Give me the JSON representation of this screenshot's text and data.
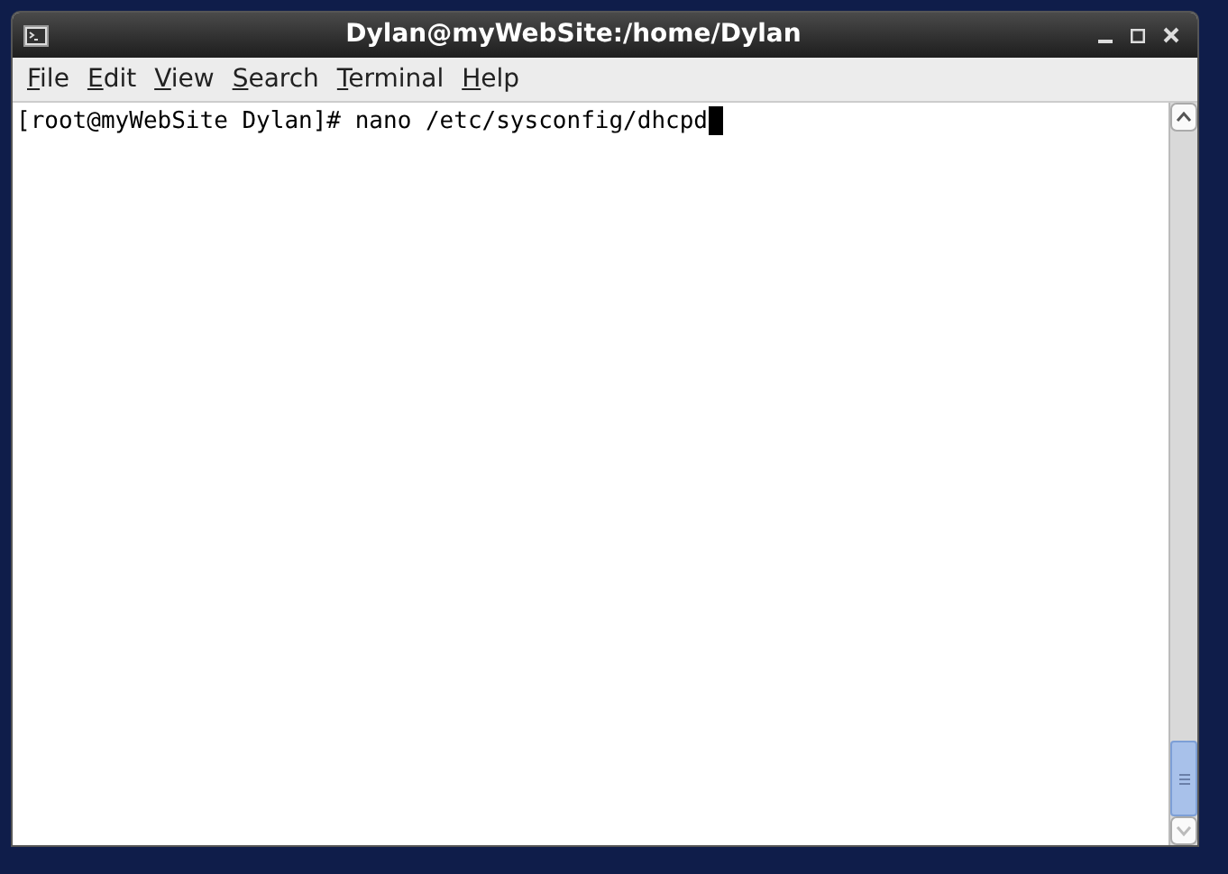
{
  "window": {
    "title": "Dylan@myWebSite:/home/Dylan"
  },
  "menu": [
    {
      "label": "File"
    },
    {
      "label": "Edit"
    },
    {
      "label": "View"
    },
    {
      "label": "Search"
    },
    {
      "label": "Terminal"
    },
    {
      "label": "Help"
    }
  ],
  "terminal": {
    "lines": [
      "[root@myWebSite Dylan]# nano /etc/sysconfig/dhcpd"
    ],
    "cursor": true
  }
}
